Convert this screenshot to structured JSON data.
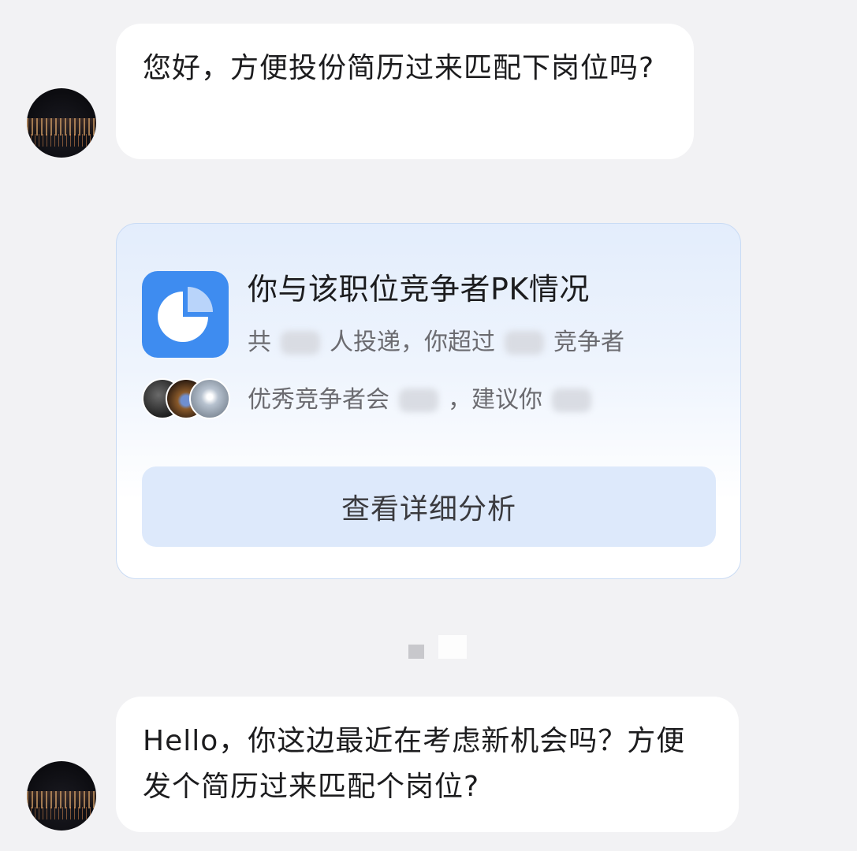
{
  "messages": [
    {
      "text": "您好，方便投份简历过来匹配下岗位吗?"
    },
    {
      "text": "Hello，你这边最近在考虑新机会吗？方便发个简历过来匹配个岗位?"
    }
  ],
  "pk_card": {
    "title": "你与该职位竞争者PK情况",
    "line1_prefix": "共",
    "line1_mid": "人投递，你超过",
    "line1_suffix": "竞争者",
    "line2_prefix": "优秀竞争者会",
    "line2_mid": "，建议你",
    "button_label": "查看详细分析",
    "icon": "pie-chart-icon",
    "accent_color": "#3e8cf0"
  }
}
